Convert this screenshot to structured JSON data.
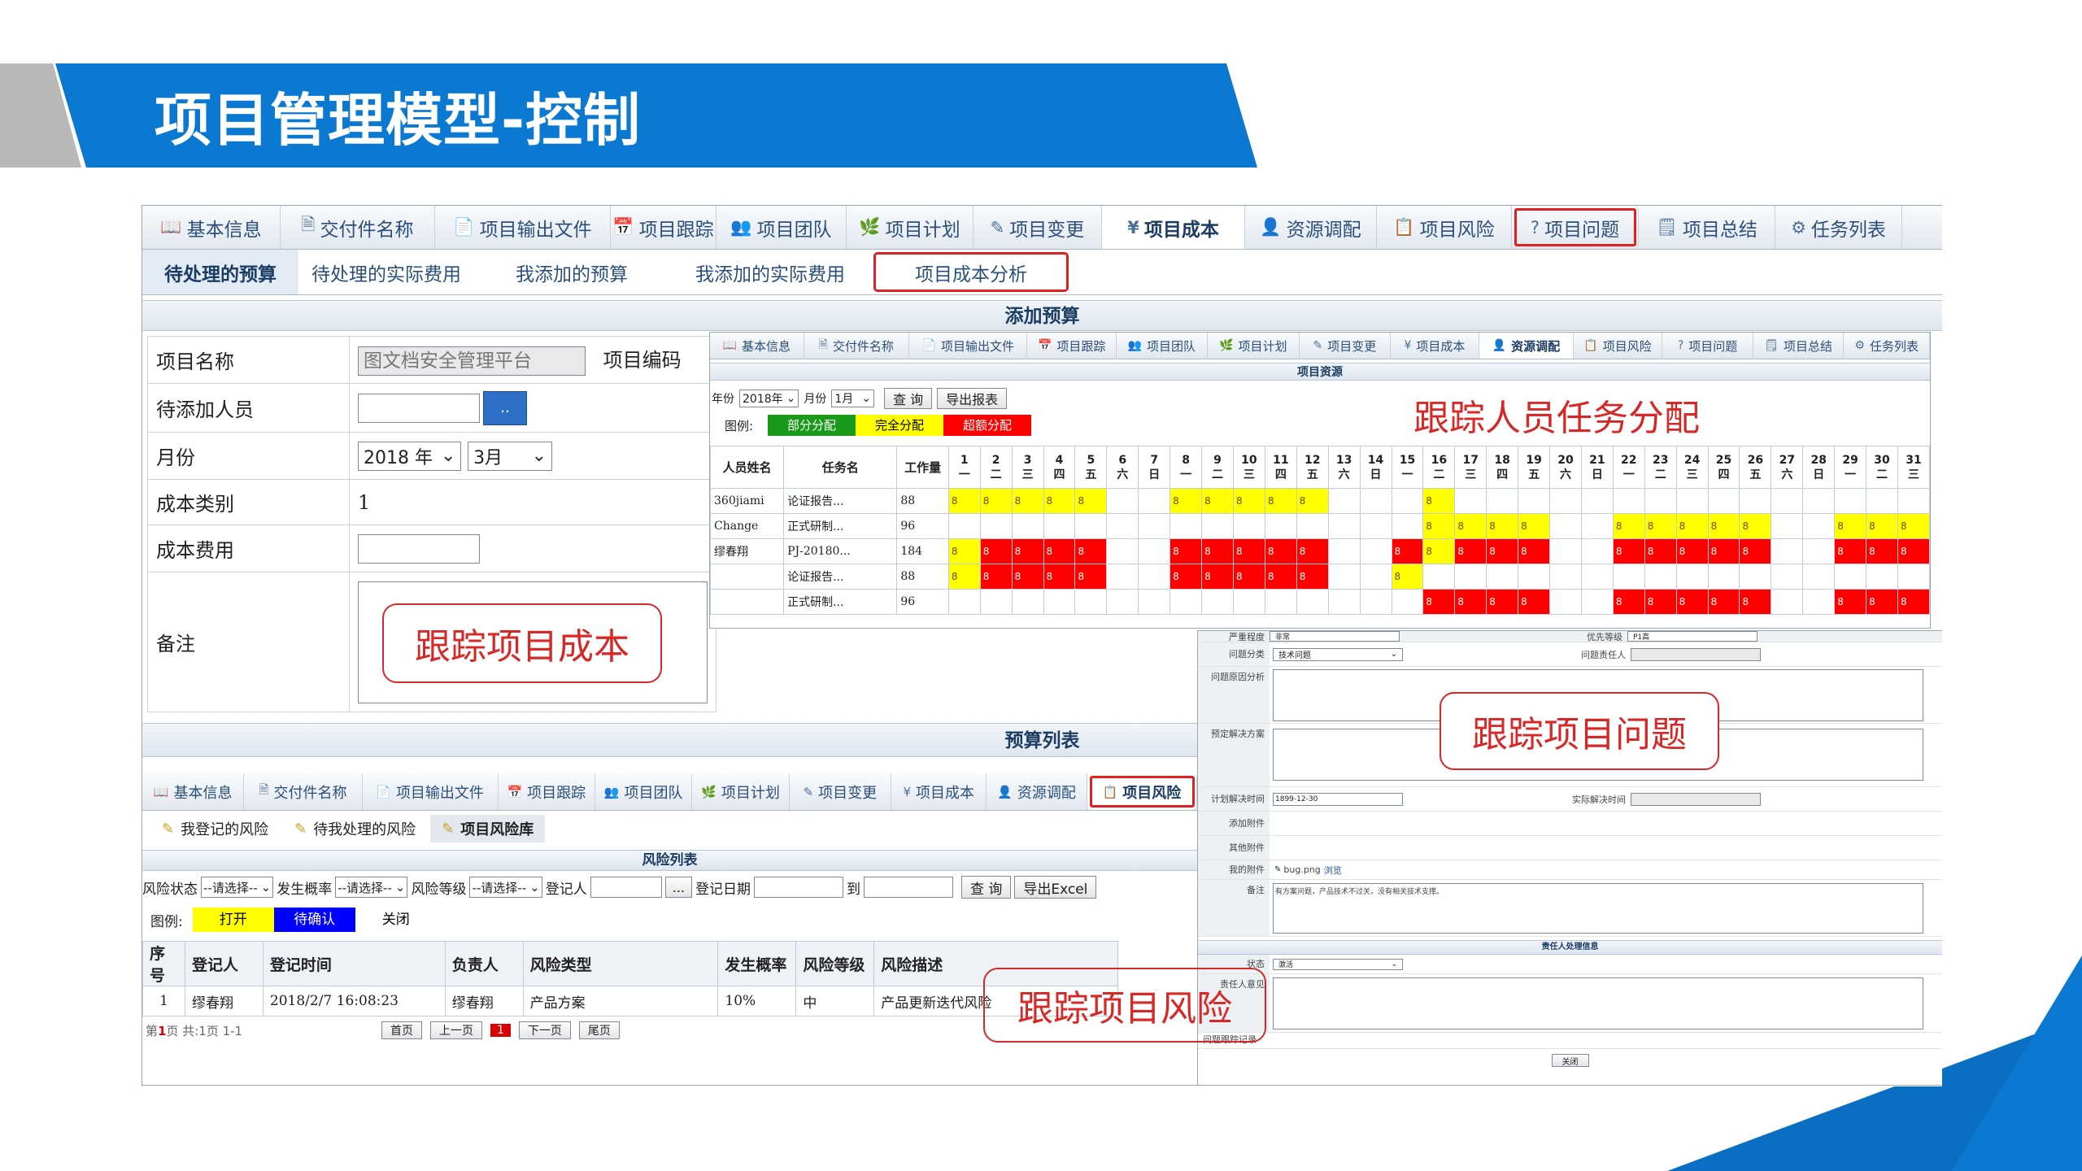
{
  "slide": {
    "title": "项目管理模型-控制"
  },
  "main_tabs": [
    {
      "label": "基本信息",
      "icon": "book-icon",
      "active": false,
      "highlight": false
    },
    {
      "label": "交付件名称",
      "icon": "document-icon",
      "active": false,
      "highlight": false
    },
    {
      "label": "项目输出文件",
      "icon": "file-export-icon",
      "active": false,
      "highlight": false
    },
    {
      "label": "项目跟踪",
      "icon": "calendar-icon",
      "active": false,
      "highlight": false
    },
    {
      "label": "项目团队",
      "icon": "team-icon",
      "active": false,
      "highlight": false
    },
    {
      "label": "项目计划",
      "icon": "plan-icon",
      "active": false,
      "highlight": false
    },
    {
      "label": "项目变更",
      "icon": "pencil-icon",
      "active": false,
      "highlight": false
    },
    {
      "label": "项目成本",
      "icon": "yen-icon",
      "active": true,
      "highlight": false
    },
    {
      "label": "资源调配",
      "icon": "user-icon",
      "active": false,
      "highlight": false
    },
    {
      "label": "项目风险",
      "icon": "risk-icon",
      "active": false,
      "highlight": false
    },
    {
      "label": "项目问题",
      "icon": "question-icon",
      "active": false,
      "highlight": true
    },
    {
      "label": "项目总结",
      "icon": "summary-icon",
      "active": false,
      "highlight": false
    },
    {
      "label": "任务列表",
      "icon": "gear-icon",
      "active": false,
      "highlight": false
    }
  ],
  "cost_subtabs": [
    {
      "label": "待处理的预算",
      "active": true,
      "highlight": false
    },
    {
      "label": "待处理的实际费用",
      "active": false,
      "highlight": false
    },
    {
      "label": "我添加的预算",
      "active": false,
      "highlight": false
    },
    {
      "label": "我添加的实际费用",
      "active": false,
      "highlight": false
    },
    {
      "label": "项目成本分析",
      "active": false,
      "highlight": true
    }
  ],
  "budget_form": {
    "section_title": "添加预算",
    "project_name_label": "项目名称",
    "project_name_value": "图文档安全管理平台",
    "project_code_label": "项目编码",
    "add_person_label": "待添加人员",
    "picker_button": "..",
    "month_label": "月份",
    "year_value": "2018 年",
    "month_value": "3月",
    "cost_type_label": "成本类别",
    "cost_type_value": "1",
    "cost_label": "成本费用",
    "remark_label": "备注"
  },
  "budget_list_title": "预算列表",
  "resource": {
    "tabs": [
      "基本信息",
      "交付件名称",
      "项目输出文件",
      "项目跟踪",
      "项目团队",
      "项目计划",
      "项目变更",
      "项目成本",
      "资源调配",
      "项目风险",
      "项目问题",
      "项目总结",
      "任务列表"
    ],
    "active_tab_index": 8,
    "section_title": "项目资源",
    "year_label": "年份",
    "year_value": "2018年",
    "month_label": "月份",
    "month_value": "1月",
    "query_button": "查 询",
    "export_button": "导出报表",
    "legend_label": "图例:",
    "legend": [
      {
        "label": "部分分配",
        "color": "#1a9a1a",
        "text_color": "#ffffff"
      },
      {
        "label": "完全分配",
        "color": "#ffff00",
        "text_color": "#000000"
      },
      {
        "label": "超额分配",
        "color": "#ff0000",
        "text_color": "#ffffff"
      }
    ],
    "headers": {
      "name": "人员姓名",
      "task": "任务名",
      "workload": "工作量"
    },
    "days": [
      {
        "d": "1",
        "w": "一"
      },
      {
        "d": "2",
        "w": "二"
      },
      {
        "d": "3",
        "w": "三"
      },
      {
        "d": "4",
        "w": "四"
      },
      {
        "d": "5",
        "w": "五"
      },
      {
        "d": "6",
        "w": "六"
      },
      {
        "d": "7",
        "w": "日"
      },
      {
        "d": "8",
        "w": "一"
      },
      {
        "d": "9",
        "w": "二"
      },
      {
        "d": "10",
        "w": "三"
      },
      {
        "d": "11",
        "w": "四"
      },
      {
        "d": "12",
        "w": "五"
      },
      {
        "d": "13",
        "w": "六"
      },
      {
        "d": "14",
        "w": "日"
      },
      {
        "d": "15",
        "w": "一"
      },
      {
        "d": "16",
        "w": "二"
      },
      {
        "d": "17",
        "w": "三"
      },
      {
        "d": "18",
        "w": "四"
      },
      {
        "d": "19",
        "w": "五"
      },
      {
        "d": "20",
        "w": "六"
      },
      {
        "d": "21",
        "w": "日"
      },
      {
        "d": "22",
        "w": "一"
      },
      {
        "d": "23",
        "w": "二"
      },
      {
        "d": "24",
        "w": "三"
      },
      {
        "d": "25",
        "w": "四"
      },
      {
        "d": "26",
        "w": "五"
      },
      {
        "d": "27",
        "w": "六"
      },
      {
        "d": "28",
        "w": "日"
      },
      {
        "d": "29",
        "w": "一"
      },
      {
        "d": "30",
        "w": "二"
      },
      {
        "d": "31",
        "w": "三"
      }
    ],
    "rows": [
      {
        "name": "360jiami",
        "task": "论证报告...",
        "workload": "88",
        "cells": "yyyyy..yyyyy...y................"
      },
      {
        "name": "Change",
        "task": "正式研制...",
        "workload": "96",
        "cells": "...............yyyy..yyyyy..yyy"
      },
      {
        "name": "缪春翔",
        "task": "PJ-20180...",
        "workload": "184",
        "cells": "yrrrr..rrrrr..ryrrr..rrrrr..rrr"
      },
      {
        "name": "",
        "task": "论证报告...",
        "workload": "88",
        "cells": "yrrrr..rrrrr..y................"
      },
      {
        "name": "",
        "task": "正式研制...",
        "workload": "96",
        "cells": "...............rrrr..rrrrr..rrr"
      }
    ],
    "cell_value": "8"
  },
  "risk": {
    "tabs": [
      "基本信息",
      "交付件名称",
      "项目输出文件",
      "项目跟踪",
      "项目团队",
      "项目计划",
      "项目变更",
      "项目成本",
      "资源调配",
      "项目风险"
    ],
    "active_tab_index": 9,
    "subtabs": [
      "我登记的风险",
      "待我处理的风险",
      "项目风险库"
    ],
    "active_subtab_index": 2,
    "section_title": "风险列表",
    "filters": {
      "status_label": "风险状态",
      "status_value": "--请选择--",
      "prob_label": "发生概率",
      "prob_value": "--请选择--",
      "level_label": "风险等级",
      "level_value": "--请选择--",
      "registrant_label": "登记人",
      "picker": "...",
      "date_label": "登记日期",
      "to_label": "到",
      "query_button": "查 询",
      "export_button": "导出Excel"
    },
    "legend_label": "图例:",
    "legend": [
      {
        "label": "打开",
        "color": "#ffff00",
        "text_color": "#000000"
      },
      {
        "label": "待确认",
        "color": "#0000ff",
        "text_color": "#ffffff"
      },
      {
        "label": "关闭",
        "color": "#ffffff",
        "text_color": "#000000"
      }
    ],
    "headers": [
      "序号",
      "登记人",
      "登记时间",
      "负责人",
      "风险类型",
      "发生概率",
      "风险等级",
      "风险描述"
    ],
    "rows": [
      [
        "1",
        "缪春翔",
        "2018/2/7 16:08:23",
        "缪春翔",
        "产品方案",
        "10%",
        "中",
        "产品更新迭代风险"
      ]
    ],
    "pager": {
      "info_prefix": "第",
      "page": "1",
      "info_suffix": "页 共:1页  1-1",
      "first": "首页",
      "prev": "上一页",
      "current": "1",
      "next": "下一页",
      "last": "尾页"
    }
  },
  "issue": {
    "priority_label": "优先等级",
    "priority_value": "P1高",
    "severity_label": "严重程度",
    "severity_value": "非常",
    "category_label": "问题分类",
    "category_value": "技术问题",
    "owner_label": "问题责任人",
    "cause_label": "问题原因分析",
    "solution_label": "预定解决方案",
    "planned_date_label": "计划解决时间",
    "planned_date_value": "1899-12-30",
    "actual_date_label": "实际解决时间",
    "attach_add_label": "添加附件",
    "attach_other_label": "其他附件",
    "attach_mine_label": "我的附件",
    "attach_file": "bug.png",
    "attach_browse": "浏览",
    "remark_label": "备注",
    "remark_value": "有方案问题，产品技术不过关，没有相关技术支撑。",
    "handler_section": "责任人处理信息",
    "status_label": "状态",
    "status_value": "激活",
    "handler_opinion_label": "责任人意见",
    "trace_label": "问题跟踪记录",
    "close_button": "关闭"
  },
  "callouts": {
    "cost": "跟踪项目成本",
    "resource": "跟踪人员任务分配",
    "issue": "跟踪项目问题",
    "risk": "跟踪项目风险"
  },
  "colors": {
    "brand": "#0b78d1",
    "callout": "#d72828",
    "partial": "#1a9a1a",
    "full": "#ffff00",
    "over": "#ff0000"
  }
}
